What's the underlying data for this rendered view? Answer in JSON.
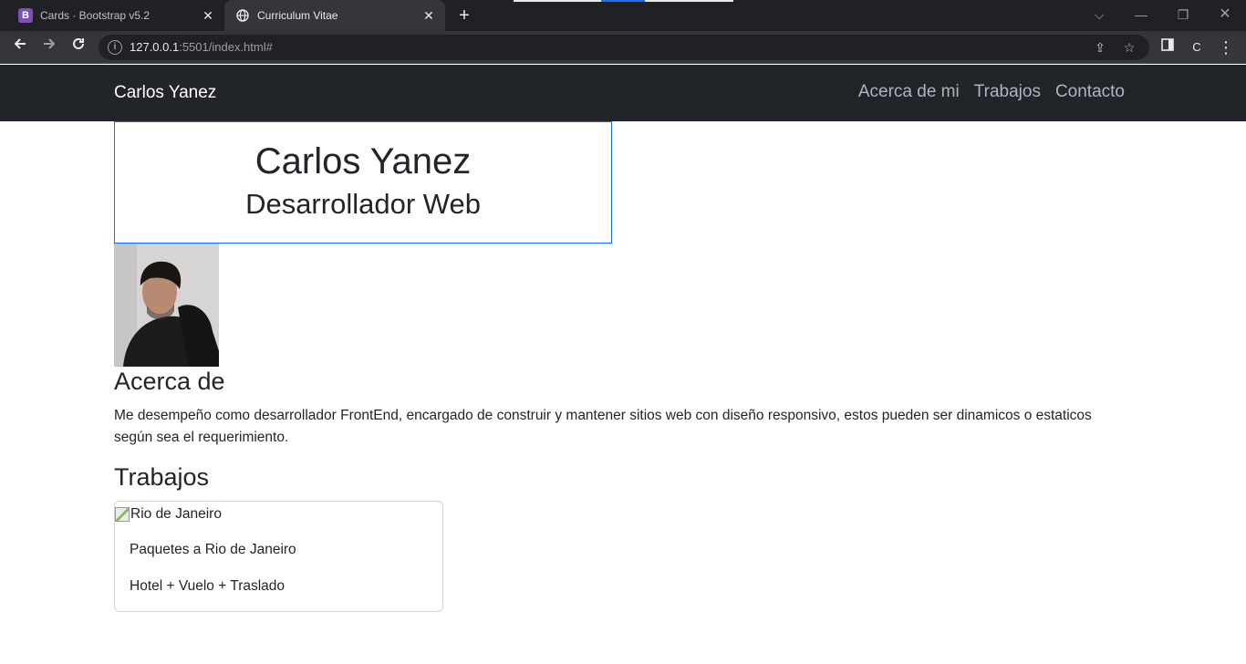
{
  "browser": {
    "tabs": [
      {
        "title": "Cards · Bootstrap v5.2",
        "favicon": "B"
      },
      {
        "title": "Curriculum Vitae"
      }
    ],
    "url_host": "127.0.0.1",
    "url_path": ":5501/index.html#",
    "profile_initial": "C"
  },
  "navbar": {
    "brand": "Carlos Yanez",
    "links": [
      "Acerca de mi",
      "Trabajos",
      "Contacto"
    ]
  },
  "hero": {
    "name": "Carlos Yanez",
    "role": "Desarrollador Web"
  },
  "about": {
    "title": "Acerca de",
    "text": "Me desempeño como desarrollador FrontEnd, encargado de construir y mantener sitios web con diseño responsivo, estos pueden ser dinamicos o estaticos según sea el requerimiento."
  },
  "works": {
    "title": "Trabajos",
    "card": {
      "image_alt": "Rio de Janeiro",
      "title": "Paquetes a Rio de Janeiro",
      "text": "Hotel + Vuelo + Traslado"
    }
  },
  "colors": {
    "navbar_bg": "#212529",
    "hero_border": "#0d6efd",
    "bootstrap_purple": "#7952b3"
  }
}
